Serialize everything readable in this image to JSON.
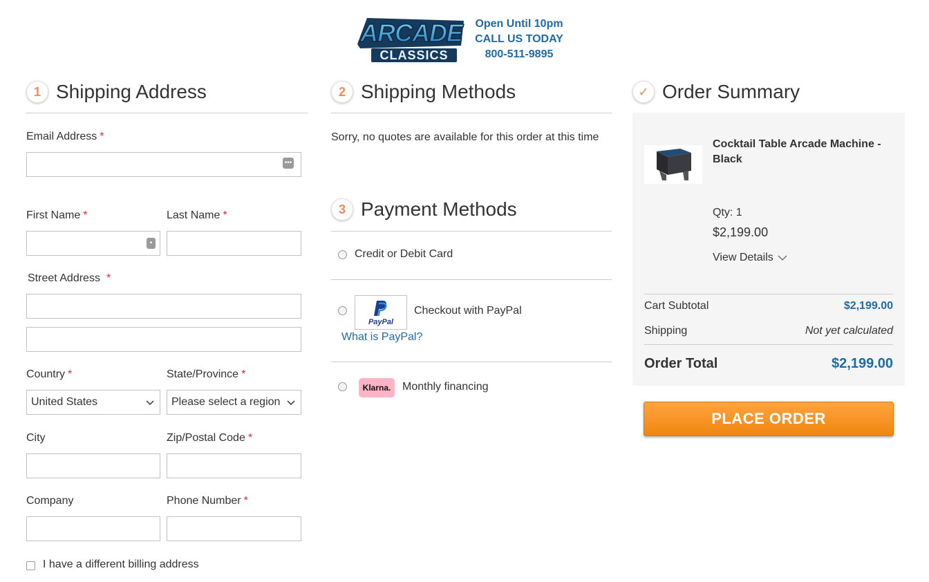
{
  "header": {
    "logo_text_top": "ARCADE",
    "logo_text_bottom": "CLASSICS",
    "hours": "Open Until 10pm",
    "call": "CALL US TODAY",
    "phone": "800-511-9895"
  },
  "shipping_address": {
    "step": "1",
    "title": "Shipping Address",
    "email_label": "Email Address",
    "first_name_label": "First Name",
    "last_name_label": "Last Name",
    "street_label": "Street Address",
    "country_label": "Country",
    "country_value": "United States",
    "state_label": "State/Province",
    "state_value": "Please select a region",
    "city_label": "City",
    "zip_label": "Zip/Postal Code",
    "company_label": "Company",
    "phone_label": "Phone Number",
    "billing_checkbox_label": "I have a different billing address",
    "required_mark": "*"
  },
  "shipping_methods": {
    "step": "2",
    "title": "Shipping Methods",
    "message": "Sorry, no quotes are available for this order at this time"
  },
  "payment_methods": {
    "step": "3",
    "title": "Payment Methods",
    "credit_card_label": "Credit or Debit Card",
    "paypal_label": "Checkout with PayPal",
    "paypal_logo_text": "PayPal",
    "paypal_link": "What is PayPal?",
    "klarna_logo_text": "Klarna.",
    "klarna_label": "Monthly financing"
  },
  "order_summary": {
    "step": "✓",
    "title": "Order Summary",
    "product_name": "Cocktail Table Arcade Machine - Black",
    "qty_label": "Qty: 1",
    "price": "$2,199.00",
    "view_details": "View Details",
    "subtotal_label": "Cart Subtotal",
    "subtotal_value": "$2,199.00",
    "shipping_label": "Shipping",
    "shipping_value": "Not yet calculated",
    "total_label": "Order Total",
    "total_value": "$2,199.00"
  },
  "place_order_label": "PLACE ORDER",
  "colors": {
    "accent_blue": "#1f6aa5",
    "step_orange": "#f08a56",
    "button_orange": "#f7941d",
    "required_red": "#e02b27"
  }
}
